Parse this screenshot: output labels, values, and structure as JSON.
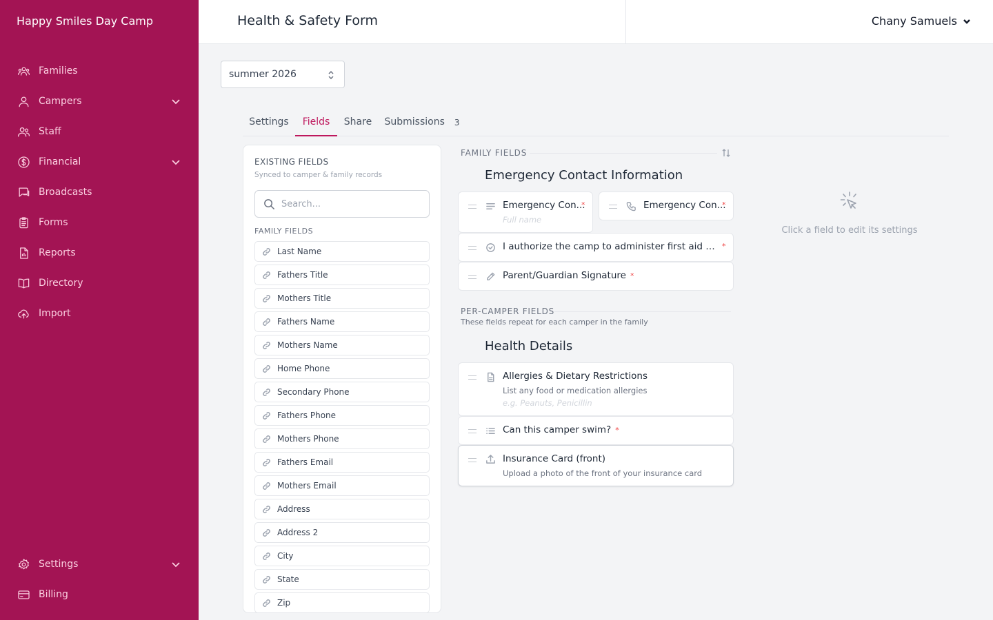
{
  "app": {
    "brand": "Happy Smiles Day Camp",
    "accent": "#a31454",
    "active_tab_color": "#be185d"
  },
  "sidebar": {
    "items": [
      {
        "label": "Families",
        "icon": "families-icon"
      },
      {
        "label": "Campers",
        "icon": "user-icon",
        "expandable": true
      },
      {
        "label": "Staff",
        "icon": "staff-icon"
      },
      {
        "label": "Financial",
        "icon": "dollar-icon",
        "expandable": true
      },
      {
        "label": "Broadcasts",
        "icon": "chat-icon"
      },
      {
        "label": "Forms",
        "icon": "clipboard-icon"
      },
      {
        "label": "Reports",
        "icon": "report-icon"
      },
      {
        "label": "Directory",
        "icon": "book-icon"
      },
      {
        "label": "Import",
        "icon": "cloud-upload-icon"
      }
    ],
    "bottom_items": [
      {
        "label": "Settings",
        "icon": "gear-icon",
        "expandable": true
      },
      {
        "label": "Billing",
        "icon": "credit-card-icon"
      }
    ]
  },
  "header": {
    "title": "Health & Safety Form",
    "user_name": "Chany Samuels"
  },
  "season": {
    "selected": "summer 2026"
  },
  "tabs": [
    {
      "label": "Settings"
    },
    {
      "label": "Fields",
      "active": true
    },
    {
      "label": "Share"
    },
    {
      "label": "Submissions",
      "count": "3"
    }
  ],
  "existing_fields": {
    "title": "EXISTING FIELDS",
    "subtitle": "Synced to camper & family records",
    "search_placeholder": "Search...",
    "section": "FAMILY FIELDS",
    "items": [
      "Last Name",
      "Fathers Title",
      "Mothers Title",
      "Fathers Name",
      "Mothers Name",
      "Home Phone",
      "Secondary Phone",
      "Fathers Phone",
      "Mothers Phone",
      "Fathers Email",
      "Mothers Email",
      "Address",
      "Address 2",
      "City",
      "State",
      "Zip"
    ]
  },
  "builder": {
    "family_section": {
      "label": "FAMILY FIELDS",
      "group_title": "Emergency Contact Information",
      "fields": [
        {
          "label": "Emergency Con...",
          "required": "*",
          "placeholder": "Full name",
          "icon": "text-lines-icon"
        },
        {
          "label": "Emergency Con...",
          "required": "*",
          "icon": "phone-icon"
        },
        {
          "label": "I authorize the camp to administer first aid and s...",
          "required": "*",
          "icon": "check-circle-icon"
        },
        {
          "label": "Parent/Guardian Signature",
          "required": "*",
          "icon": "pen-icon"
        }
      ]
    },
    "camper_section": {
      "label": "PER-CAMPER FIELDS",
      "description": "These fields repeat for each camper in the family",
      "group_title": "Health Details",
      "fields": [
        {
          "label": "Allergies & Dietary Restrictions",
          "help": "List any food or medication allergies",
          "placeholder": "e.g. Peanuts, Penicillin",
          "icon": "document-icon"
        },
        {
          "label": "Can this camper swim?",
          "required": "*",
          "icon": "list-icon"
        },
        {
          "label": "Insurance Card (front)",
          "help": "Upload a photo of the front of your insurance card",
          "icon": "upload-icon"
        }
      ]
    }
  },
  "edit_panel": {
    "hint": "Click a field to edit its settings",
    "icon": "cursor-click-icon"
  }
}
